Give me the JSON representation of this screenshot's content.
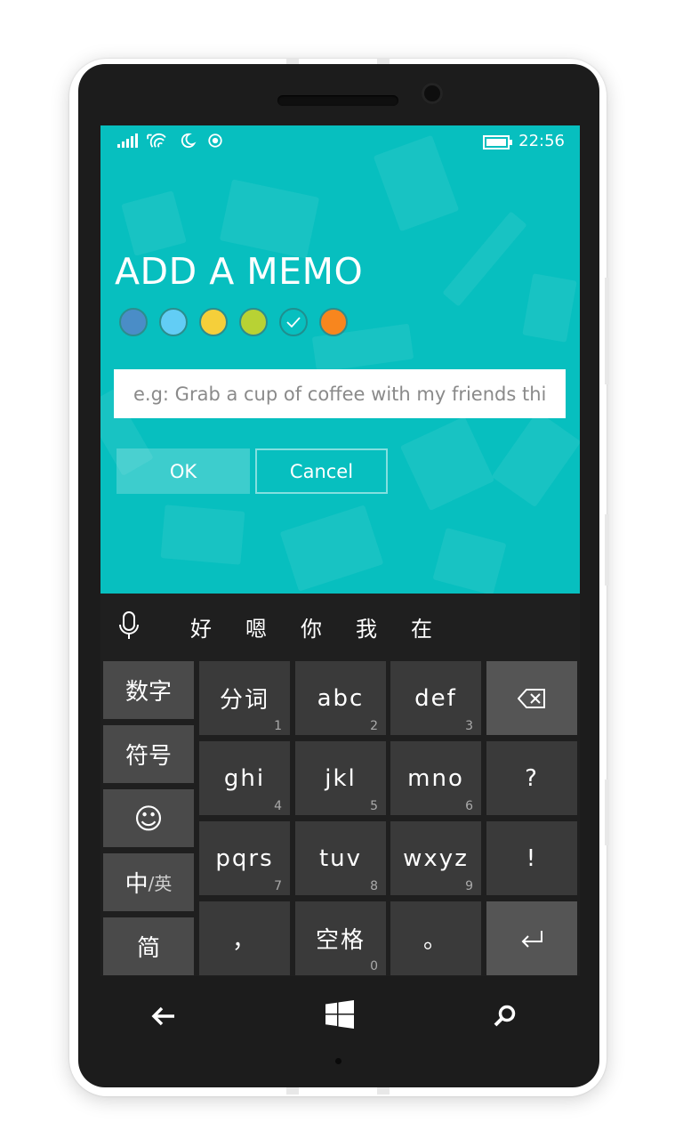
{
  "colors": {
    "app_background": "#07bfbf",
    "keyboard_background": "#1f1f1f",
    "key_main": "#3a3a3a",
    "key_side": "#4a4a4a",
    "key_action": "#555555"
  },
  "status_bar": {
    "time": "22:56",
    "icons": [
      "signal-icon",
      "wifi-icon",
      "quiet-hours-icon",
      "location-icon",
      "battery-icon"
    ]
  },
  "memo": {
    "title": "ADD A MEMO",
    "color_swatches": [
      {
        "color": "#4a8dc7",
        "selected": false
      },
      {
        "color": "#62cdf5",
        "selected": false
      },
      {
        "color": "#f5cf3a",
        "selected": false
      },
      {
        "color": "#b8d234",
        "selected": false
      },
      {
        "color": "#07bfbf",
        "selected": true
      },
      {
        "color": "#f8861e",
        "selected": false
      }
    ],
    "input_value": "",
    "input_placeholder": "e.g: Grab a cup of coffee with my friends this",
    "ok_label": "OK",
    "cancel_label": "Cancel"
  },
  "keyboard": {
    "mic_icon": "microphone-icon",
    "candidates": [
      "好",
      "嗯",
      "你",
      "我",
      "在"
    ],
    "side_keys": {
      "numbers": "数字",
      "symbols": "符号",
      "emoji": "☺",
      "lang_main": "中",
      "lang_sub": "/英",
      "simplified": "简"
    },
    "rows": [
      [
        {
          "label": "分词",
          "num": "1"
        },
        {
          "label": "abc",
          "num": "2"
        },
        {
          "label": "def",
          "num": "3"
        }
      ],
      [
        {
          "label": "ghi",
          "num": "4"
        },
        {
          "label": "jkl",
          "num": "5"
        },
        {
          "label": "mno",
          "num": "6"
        }
      ],
      [
        {
          "label": "pqrs",
          "num": "7"
        },
        {
          "label": "tuv",
          "num": "8"
        },
        {
          "label": "wxyz",
          "num": "9"
        }
      ],
      [
        {
          "label": "，",
          "num": ""
        },
        {
          "label": "空格",
          "num": "0"
        },
        {
          "label": "。",
          "num": ""
        }
      ]
    ],
    "action_keys": {
      "backspace_icon": "backspace-icon",
      "question": "?",
      "exclamation": "!",
      "enter_icon": "enter-icon"
    }
  },
  "navbar": {
    "back_icon": "back-arrow-icon",
    "home_icon": "windows-logo-icon",
    "search_icon": "search-icon"
  }
}
